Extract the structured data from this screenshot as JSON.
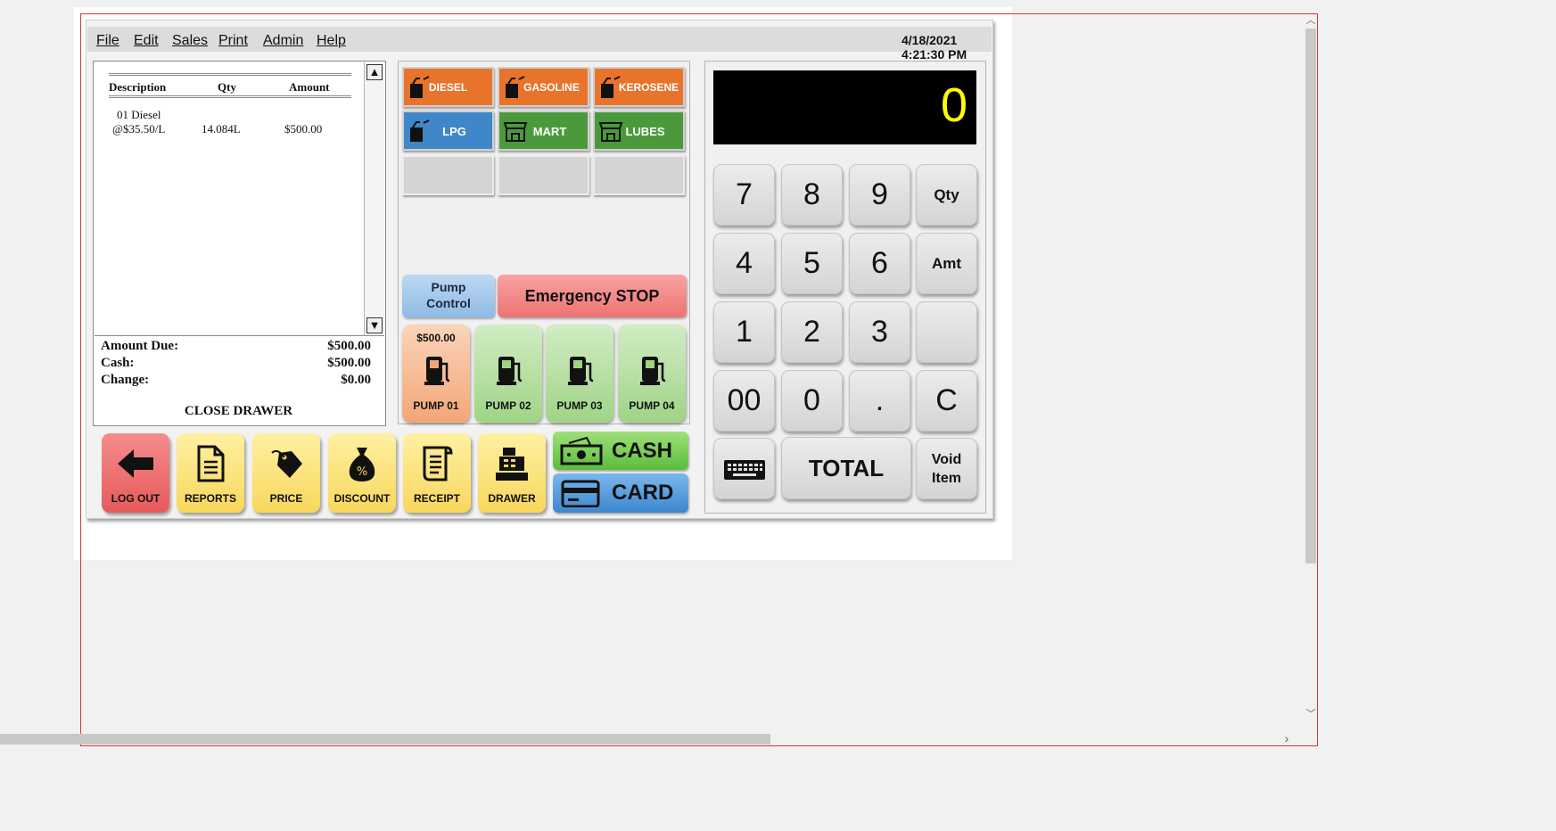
{
  "menu": [
    "File",
    "Edit",
    "Sales",
    "Print",
    "Admin",
    "Help"
  ],
  "datetime": "4/18/2021 4:21:30 PM",
  "receipt": {
    "headers": {
      "description": "Description",
      "qty": "Qty",
      "amount": "Amount"
    },
    "items": [
      {
        "line1": "01 Diesel",
        "line2": "@$35.50/L",
        "qty": "14.084L",
        "amount": "$500.00"
      }
    ],
    "totals": [
      {
        "label": "Amount Due:",
        "value": "$500.00"
      },
      {
        "label": "Cash:",
        "value": "$500.00"
      },
      {
        "label": "Change:",
        "value": "$0.00"
      }
    ],
    "footer": "CLOSE DRAWER"
  },
  "products": [
    {
      "label": "DIESEL",
      "icon": "fuel-can-icon",
      "color": "#e8742c"
    },
    {
      "label": "GASOLINE",
      "icon": "fuel-can-icon",
      "color": "#e8742c"
    },
    {
      "label": "KEROSENE",
      "icon": "fuel-can-icon",
      "color": "#e8742c"
    },
    {
      "label": "LPG",
      "icon": "fuel-can-icon",
      "color": "#3f87c8"
    },
    {
      "label": "MART",
      "icon": "store-icon",
      "color": "#4a9a3c"
    },
    {
      "label": "LUBES",
      "icon": "store-icon",
      "color": "#4a9a3c"
    }
  ],
  "pump_control": {
    "line1": "Pump",
    "line2": "Control"
  },
  "emergency_stop": "Emergency STOP",
  "pumps": [
    {
      "label": "PUMP 01",
      "amount": "$500.00",
      "color": "#f3a676"
    },
    {
      "label": "PUMP 02",
      "amount": "",
      "color": "#9fd486"
    },
    {
      "label": "PUMP 03",
      "amount": "",
      "color": "#9fd486"
    },
    {
      "label": "PUMP 04",
      "amount": "",
      "color": "#9fd486"
    }
  ],
  "actions": [
    {
      "label": "LOG OUT",
      "icon": "arrow-left-icon"
    },
    {
      "label": "REPORTS",
      "icon": "document-icon"
    },
    {
      "label": "PRICE",
      "icon": "price-tag-icon"
    },
    {
      "label": "DISCOUNT",
      "icon": "money-bag-icon"
    },
    {
      "label": "RECEIPT",
      "icon": "receipt-icon"
    },
    {
      "label": "DRAWER",
      "icon": "cash-register-icon"
    }
  ],
  "payments": {
    "cash": "CASH",
    "card": "CARD"
  },
  "display_value": "0",
  "keypad": {
    "k7": "7",
    "k8": "8",
    "k9": "9",
    "qty": "Qty",
    "k4": "4",
    "k5": "5",
    "k6": "6",
    "amt": "Amt",
    "k1": "1",
    "k2": "2",
    "k3": "3",
    "k00": "00",
    "k0": "0",
    "dot": ".",
    "clear": "C",
    "total": "TOTAL",
    "void_line1": "Void",
    "void_line2": "Item"
  }
}
